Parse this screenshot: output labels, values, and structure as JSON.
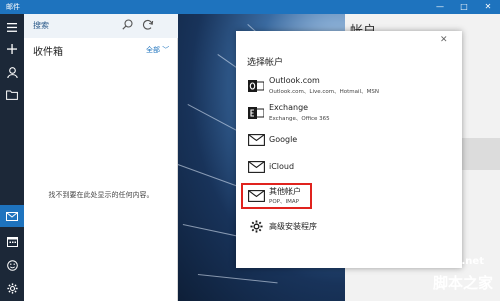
{
  "window": {
    "title": "邮件",
    "min_glyph": "—",
    "max_glyph": "□",
    "close_glyph": "✕"
  },
  "folder_pane": {
    "search_placeholder": "搜索",
    "inbox_title": "收件箱",
    "filter_label": "全部 ﹀",
    "empty_message": "找不到要在此处显示的任何内容。"
  },
  "account_panel": {
    "title": "帐户"
  },
  "dialog": {
    "title": "选择帐户",
    "close_glyph": "✕",
    "items": [
      {
        "name": "Outlook.com",
        "sub": "Outlook.com、Live.com、Hotmail、MSN",
        "icon": "outlook-icon"
      },
      {
        "name": "Exchange",
        "sub": "Exchange、Office 365",
        "icon": "exchange-icon"
      },
      {
        "name": "Google",
        "sub": "",
        "icon": "mail-icon"
      },
      {
        "name": "iCloud",
        "sub": "",
        "icon": "mail-icon"
      },
      {
        "name": "其他帐户",
        "sub": "POP、IMAP",
        "icon": "mail-icon"
      },
      {
        "name": "高级安装程序",
        "sub": "",
        "icon": "gear-icon"
      }
    ]
  },
  "watermark": {
    "line1": "jb51.net",
    "line2": "脚本之家"
  },
  "colors": {
    "accent": "#1e73be",
    "rail": "#1c2838",
    "highlight": "#e0231e"
  }
}
